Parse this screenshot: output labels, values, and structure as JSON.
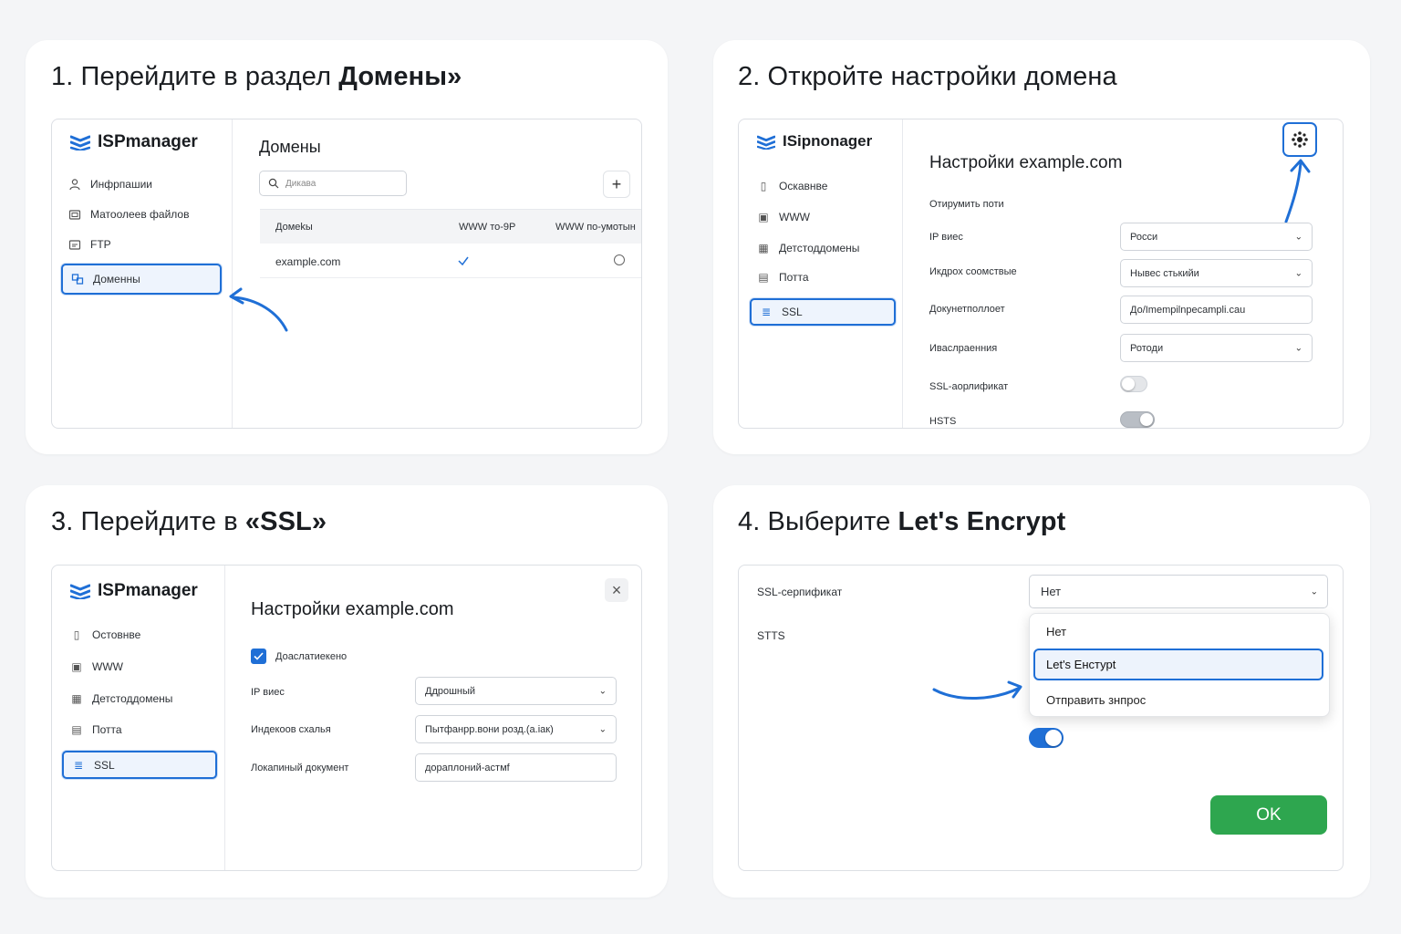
{
  "step1": {
    "title_prefix": "1. Перейдите в раздел ",
    "title_bold": "Домены»",
    "logo_text": "ISPmanager",
    "nav": [
      "Инфрпашии",
      "Матоолеев файлов",
      "FTP",
      "Доменны"
    ],
    "panel_title": "Домены",
    "search_placeholder": "Дикава",
    "add_label": "+",
    "columns": [
      "Домеkы",
      "WWW то-9Р",
      "WWW по-умотын"
    ],
    "rows": [
      {
        "domain": "example.com",
        "www": "✓",
        "www_default": "○"
      }
    ]
  },
  "step2": {
    "title": "2. Откройте настройки домена",
    "logo_text": "ISipnonager",
    "nav": [
      "Оскавнве",
      "WWW",
      "Детстоддомены",
      "Потта",
      "SSL"
    ],
    "panel_title": "Настройки example.com",
    "section_label": "Отирумить поти",
    "fields": [
      {
        "label": "IP виес",
        "value": "Росси"
      },
      {
        "label": "Икдрох соомствые",
        "value": "Нывес стькийи"
      },
      {
        "label": "Докунетполлоет",
        "value": "До/Imempilnpecampli.cau"
      },
      {
        "label": "Иваслраенния",
        "value": "Ротоди"
      }
    ],
    "ssl_label": "SSL-аорлификат",
    "hsts_label": "HSTS"
  },
  "step3": {
    "title_prefix": "3. Перейдите в ",
    "title_bold": "«SSL»",
    "logo_text": "ISPmanager",
    "nav": [
      "Остовнве",
      "WWW",
      "Детстоддомены",
      "Потта",
      "SSL"
    ],
    "panel_title": "Настройки example.com",
    "checkbox_label": "Доаслатиекено",
    "fields": [
      {
        "label": "IP виес",
        "value": "Ддрошный"
      },
      {
        "label": "Индекоов схалья",
        "value": "Пытфанрр.вони розд.(а.іак)"
      },
      {
        "label": "Локапиный документ",
        "value": "дораплоний-астмf"
      }
    ],
    "close_label": "×"
  },
  "step4": {
    "title_prefix": "4. Выберите ",
    "title_bold": "Let's Encrypt",
    "ssl_label": "SSL-серпификат",
    "ssl_value": "Нет",
    "stts_label": "STTS",
    "options": [
      "Нет",
      "Let's Енстурt",
      "Отправить знпрос"
    ],
    "ok_label": "OK"
  },
  "colors": {
    "accent": "#1f6fd6",
    "ok_button": "#2ea64f",
    "card_bg": "#ffffff",
    "page_bg": "#f4f5f7"
  }
}
